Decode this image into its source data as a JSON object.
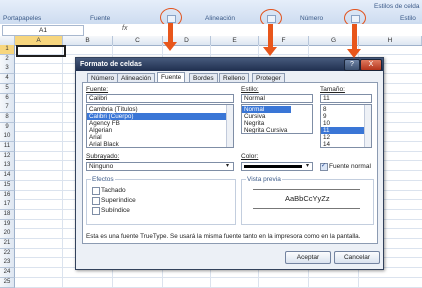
{
  "ribbon": {
    "groups": [
      "Portapapeles",
      "Fuente",
      "Alineación",
      "Número",
      "Estilo"
    ],
    "top_right_text": "Estilos de celda"
  },
  "formula_bar": {
    "name_box": "A1",
    "fx": "fx"
  },
  "columns": [
    "A",
    "B",
    "C",
    "D",
    "E",
    "F",
    "G",
    "H"
  ],
  "rows": [
    "1",
    "2",
    "3",
    "4",
    "5",
    "6",
    "7",
    "8",
    "9",
    "10",
    "11",
    "12",
    "13",
    "14",
    "15",
    "16",
    "17",
    "18",
    "19",
    "20",
    "21",
    "22",
    "23",
    "24",
    "25"
  ],
  "dialog": {
    "title": "Formato de celdas",
    "help_btn": "?",
    "close_btn": "X",
    "tabs": [
      "Número",
      "Alineación",
      "Fuente",
      "Bordes",
      "Relleno",
      "Proteger"
    ],
    "selected_tab": "Fuente",
    "font_label": "Fuente:",
    "font_value": "Calibri",
    "font_list": [
      "Cambria (Títulos)",
      "Calibri (Cuerpo)",
      "Agency FB",
      "Algerian",
      "Arial",
      "Arial Black"
    ],
    "font_selected_index": 1,
    "style_label": "Estilo:",
    "style_value": "Normal",
    "style_list": [
      "Normal",
      "Cursiva",
      "Negrita",
      "Negrita Cursiva"
    ],
    "style_selected_index": 0,
    "size_label": "Tamaño:",
    "size_value": "11",
    "size_list": [
      "8",
      "9",
      "10",
      "11",
      "12",
      "14"
    ],
    "size_selected_index": 3,
    "underline_label": "Subrayado:",
    "underline_value": "Ninguno",
    "color_label": "Color:",
    "normal_font_label": "Fuente normal",
    "normal_font_checked": true,
    "effects_label": "Efectos",
    "effects": [
      "Tachado",
      "Superíndice",
      "Subíndice"
    ],
    "preview_label": "Vista previa",
    "preview_text": "AaBbCcYyZz",
    "info_text": "Esta es una fuente TrueType. Se usará la misma fuente tanto en la impresora como en la pantalla.",
    "ok_button": "Aceptar",
    "cancel_button": "Cancelar"
  },
  "colors": {
    "accent_arrow": "#e8561b",
    "title_bar": "#1f2f4f",
    "selection": "#3a76d6"
  }
}
